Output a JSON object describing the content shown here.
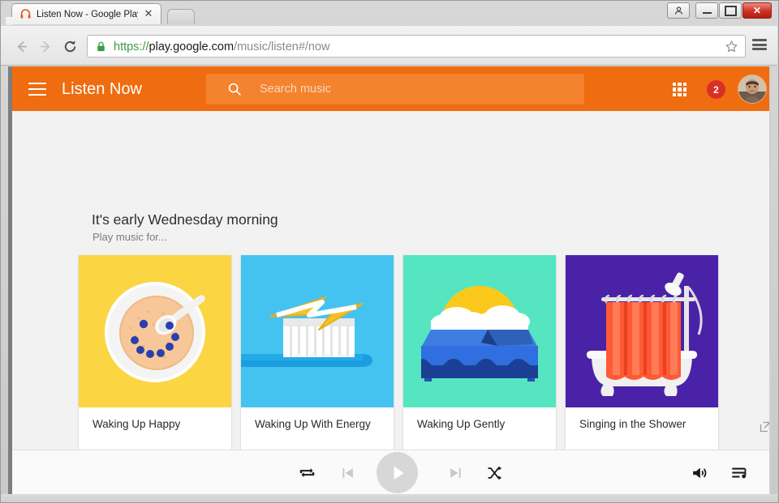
{
  "window": {
    "controls": {
      "user_icon": "user-icon",
      "minimize": "minimize-icon",
      "maximize": "maximize-icon",
      "close": "✕"
    }
  },
  "browser": {
    "tab": {
      "title": "Listen Now - Google Play",
      "favicon": "headphones-icon",
      "close": "✕"
    },
    "new_tab_label": "",
    "nav": {
      "back": "back-arrow-icon",
      "forward": "forward-arrow-icon",
      "reload": "reload-icon"
    },
    "omnibox": {
      "lock": "lock-icon",
      "scheme": "https://",
      "host": "play.google.com",
      "path": "/music/listen#/now",
      "bookmark": "star-icon"
    },
    "menu": "chrome-menu-icon"
  },
  "appbar": {
    "menu_icon": "hamburger-icon",
    "title": "Listen Now",
    "search": {
      "icon": "search-icon",
      "placeholder": "Search music",
      "value": ""
    },
    "apps_icon": "apps-grid-icon",
    "notification_count": "2",
    "avatar": "user-avatar",
    "color": "#ef6c10",
    "search_color": "#f4822e"
  },
  "main": {
    "heading": "It's early Wednesday morning",
    "subheading": "Play music for...",
    "cards": [
      {
        "title": "Waking Up Happy",
        "art": "oatmeal-bowl",
        "bg": "#fbd642"
      },
      {
        "title": "Waking Up With Energy",
        "art": "toothbrush",
        "bg": "#45c3f0"
      },
      {
        "title": "Waking Up Gently",
        "art": "bed-sunrise",
        "bg": "#55e6c1"
      },
      {
        "title": "Singing in the Shower",
        "art": "bathtub",
        "bg": "#4a22a8"
      }
    ]
  },
  "player": {
    "repeat": "repeat-icon",
    "previous": "previous-track-icon",
    "play": "play-icon",
    "next": "next-track-icon",
    "shuffle": "shuffle-icon",
    "volume": "volume-icon",
    "queue": "queue-icon",
    "popout": "popout-icon"
  }
}
